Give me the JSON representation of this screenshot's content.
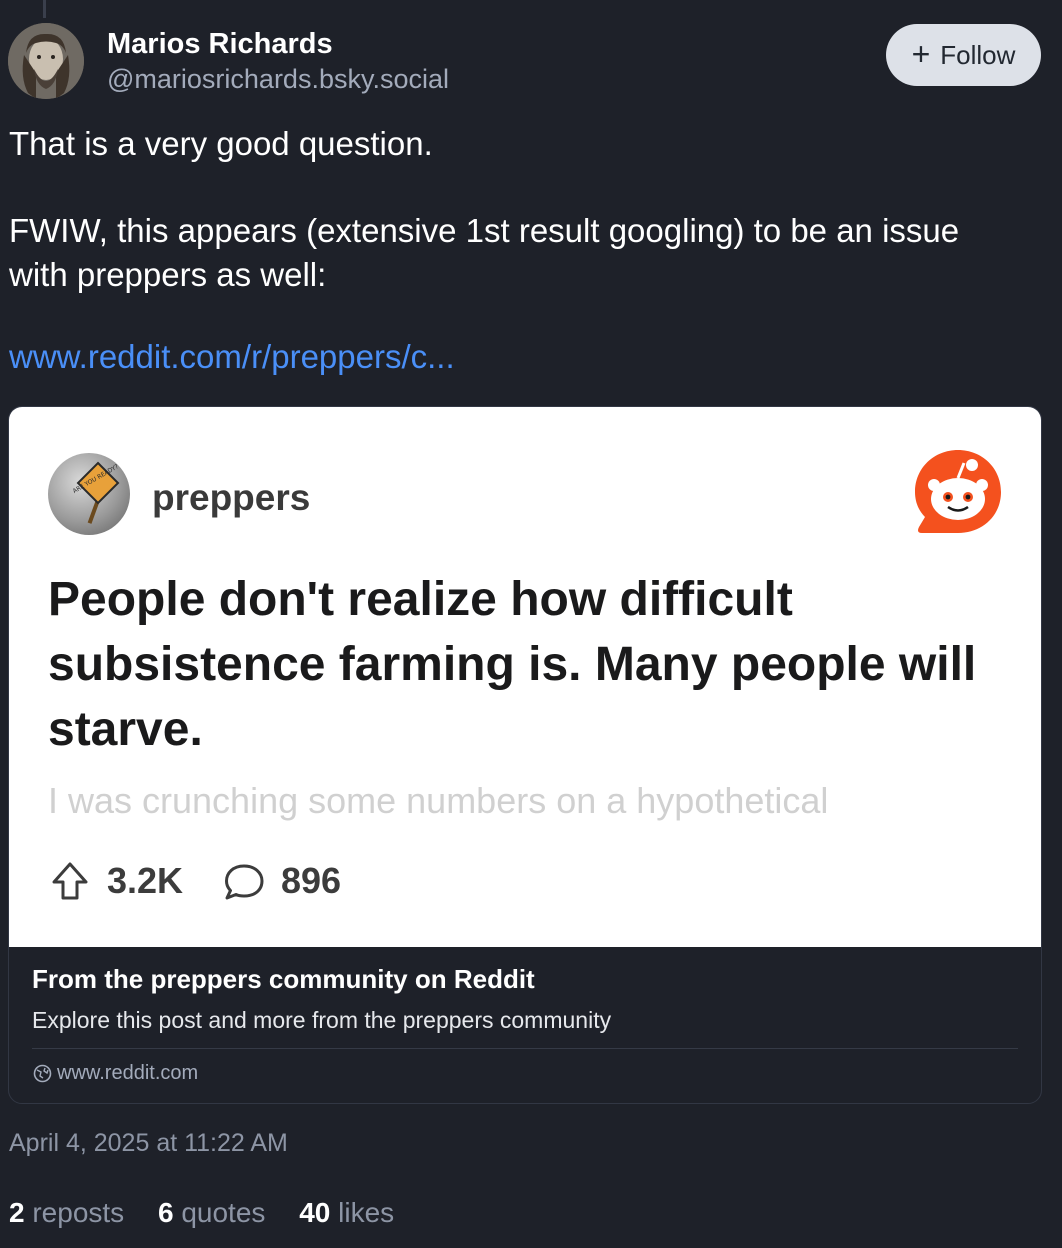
{
  "author": {
    "name": "Marios Richards",
    "handle": "@mariosrichards.bsky.social"
  },
  "follow_button": {
    "icon": "plus-icon",
    "label": "Follow"
  },
  "post": {
    "paragraphs": [
      "That is a very good question.",
      "FWIW, this appears (extensive 1st result googling) to be an issue",
      "with preppers as well:"
    ],
    "link_text": "www.reddit.com/r/preppers/c..."
  },
  "embed": {
    "subreddit": "preppers",
    "badge_text": "ARE YOU READY?",
    "post_title": "People don't realize how difficult subsistence farming is. Many people will starve.",
    "excerpt": "I was crunching some numbers on a hypothetical",
    "upvotes": "3.2K",
    "comments": "896",
    "card_title": "From the preppers community on Reddit",
    "card_description": "Explore this post and more from the preppers community",
    "domain": "www.reddit.com"
  },
  "timestamp": "April 4, 2025 at 11:22 AM",
  "stats": {
    "reposts_count": "2",
    "reposts_label": "reposts",
    "quotes_count": "6",
    "quotes_label": "quotes",
    "likes_count": "40",
    "likes_label": "likes"
  },
  "colors": {
    "background": "#1e2129",
    "link": "#4a8ff7",
    "muted": "#8d95a5",
    "reddit_orange": "#f4511e"
  }
}
